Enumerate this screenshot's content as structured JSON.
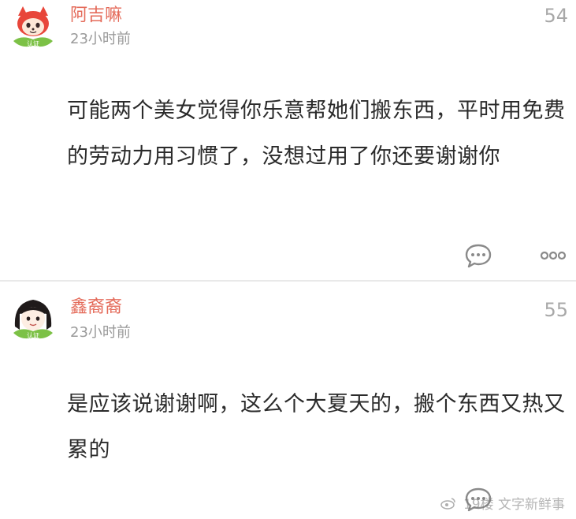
{
  "comments": [
    {
      "username": "阿吉嘛",
      "time": "23小时前",
      "floor": "54",
      "text": "可能两个美女觉得你乐意帮她们搬东西，平时用免费的劳动力用习惯了，没想过用了你还要谢谢你",
      "avatar_badge": "认证",
      "avatar_icon": "red-fox-avatar-icon",
      "actions": [
        "reply-icon",
        "more-icon"
      ]
    },
    {
      "username": "鑫裔裔",
      "time": "23小时前",
      "floor": "55",
      "text": "是应该说谢谢啊，这么个大夏天的，搬个东西又热又累的",
      "avatar_badge": "认证",
      "avatar_icon": "girl-avatar-icon",
      "actions": [
        "reply-icon",
        "more-icon"
      ]
    }
  ],
  "watermark": {
    "floor_label": "19楼",
    "source": "文字新鲜事"
  },
  "colors": {
    "username": "#e46a59",
    "text": "#2b2b2b",
    "meta": "#9a9a9a",
    "divider": "#e9e9e9"
  }
}
